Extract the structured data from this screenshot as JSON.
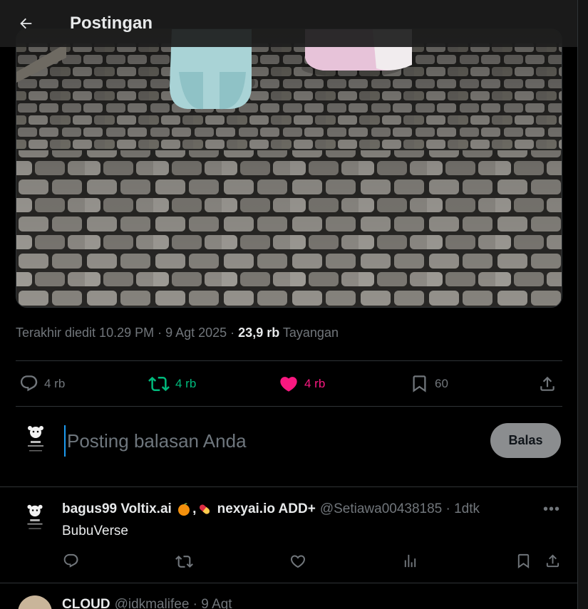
{
  "header": {
    "title": "Postingan",
    "back_icon": "arrow-left-icon"
  },
  "post": {
    "meta_prefix": "Terakhir diedit 10.29 PM · 9 Agt 2025 · ",
    "views_count": "23,9 rb",
    "views_label": " Tayangan",
    "replies": "4 rb",
    "reposts": "4 rb",
    "likes": "4 rb",
    "bookmarks": "60",
    "repost_color": "#00ba7c",
    "like_color": "#f91880"
  },
  "compose": {
    "placeholder": "Posting balasan Anda",
    "reply_button": "Balas"
  },
  "replies": [
    {
      "name_part1": "bagus99 Voltix.ai ",
      "emoji1": "orange-icon",
      "comma": ",",
      "emoji2": "pill-icon",
      "name_part2": " nexyai.io ADD+",
      "handle": "@Setiawa00438185 · 1dtk",
      "text": "BubuVerse"
    }
  ],
  "next_reply": {
    "name": "CLOUD",
    "handle": "@idkmalifee · 9 Agt"
  }
}
